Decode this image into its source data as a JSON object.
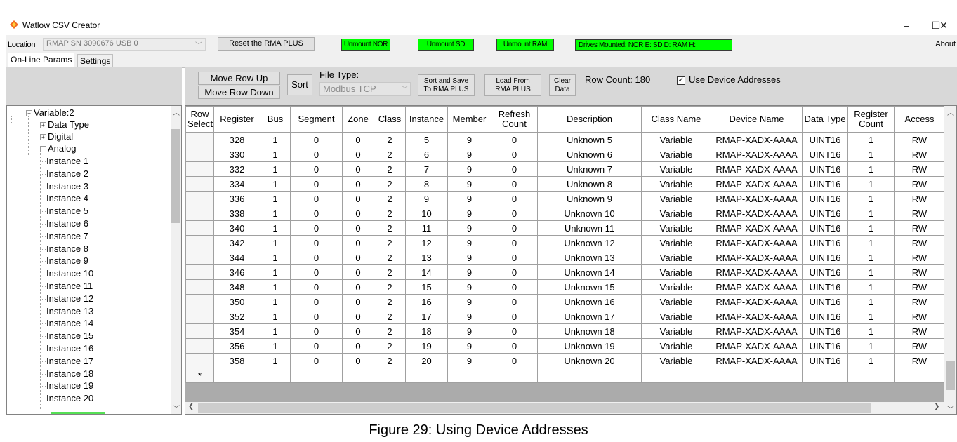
{
  "window": {
    "title": "Watlow CSV Creator",
    "minimize": "–",
    "maximize": "☐",
    "close": "✕",
    "app_icon": "watlow-logo-icon"
  },
  "toolbar": {
    "location_label": "Location",
    "location_value": "RMAP SN 3090676 USB 0",
    "reset_label": "Reset the RMA PLUS",
    "unmount_nor_label": "Unmount NOR",
    "unmount_sd_label": "Unmount SD",
    "unmount_ram_label": "Unmount RAM",
    "drives_status": "Drives Mounted: NOR E: SD D: RAM H:",
    "about_label": "About",
    "status_color": "#00ff00"
  },
  "tabs": [
    {
      "label": "On-Line Params",
      "active": true
    },
    {
      "label": "Settings",
      "active": false
    }
  ],
  "actions": {
    "move_up": "Move Row Up",
    "move_down": "Move Row Down",
    "sort": "Sort",
    "file_type_label": "File Type:",
    "file_type_value": "Modbus TCP",
    "sort_save_line1": "Sort and Save",
    "sort_save_line2": "To RMA PLUS",
    "load_line1": "Load From",
    "load_line2": "RMA PLUS",
    "clear_line1": "Clear",
    "clear_line2": "Data",
    "row_count": "Row Count: 180",
    "use_device_addresses": "Use Device Addresses",
    "use_device_addresses_checked": true
  },
  "tree": {
    "root": "Variable:2",
    "children": [
      "Data Type",
      "Digital",
      "Analog"
    ],
    "instances": [
      "Instance 1",
      "Instance 2",
      "Instance 3",
      "Instance 4",
      "Instance 5",
      "Instance 6",
      "Instance 7",
      "Instance 8",
      "Instance 9",
      "Instance 10",
      "Instance 11",
      "Instance 12",
      "Instance 13",
      "Instance 14",
      "Instance 15",
      "Instance 16",
      "Instance 17",
      "Instance 18",
      "Instance 19",
      "Instance 20"
    ]
  },
  "grid": {
    "columns": [
      "Row Select",
      "Register",
      "Bus",
      "Segment",
      "Zone",
      "Class",
      "Instance",
      "Member",
      "Refresh Count",
      "Description",
      "Class Name",
      "Device Name",
      "Data Type",
      "Register Count",
      "Access"
    ],
    "rows": [
      [
        "",
        "328",
        "1",
        "0",
        "0",
        "2",
        "5",
        "9",
        "0",
        "Unknown 5",
        "Variable",
        "RMAP-XADX-AAAA",
        "UINT16",
        "1",
        "RW"
      ],
      [
        "",
        "330",
        "1",
        "0",
        "0",
        "2",
        "6",
        "9",
        "0",
        "Unknown 6",
        "Variable",
        "RMAP-XADX-AAAA",
        "UINT16",
        "1",
        "RW"
      ],
      [
        "",
        "332",
        "1",
        "0",
        "0",
        "2",
        "7",
        "9",
        "0",
        "Unknown 7",
        "Variable",
        "RMAP-XADX-AAAA",
        "UINT16",
        "1",
        "RW"
      ],
      [
        "",
        "334",
        "1",
        "0",
        "0",
        "2",
        "8",
        "9",
        "0",
        "Unknown 8",
        "Variable",
        "RMAP-XADX-AAAA",
        "UINT16",
        "1",
        "RW"
      ],
      [
        "",
        "336",
        "1",
        "0",
        "0",
        "2",
        "9",
        "9",
        "0",
        "Unknown 9",
        "Variable",
        "RMAP-XADX-AAAA",
        "UINT16",
        "1",
        "RW"
      ],
      [
        "",
        "338",
        "1",
        "0",
        "0",
        "2",
        "10",
        "9",
        "0",
        "Unknown 10",
        "Variable",
        "RMAP-XADX-AAAA",
        "UINT16",
        "1",
        "RW"
      ],
      [
        "",
        "340",
        "1",
        "0",
        "0",
        "2",
        "11",
        "9",
        "0",
        "Unknown 11",
        "Variable",
        "RMAP-XADX-AAAA",
        "UINT16",
        "1",
        "RW"
      ],
      [
        "",
        "342",
        "1",
        "0",
        "0",
        "2",
        "12",
        "9",
        "0",
        "Unknown 12",
        "Variable",
        "RMAP-XADX-AAAA",
        "UINT16",
        "1",
        "RW"
      ],
      [
        "",
        "344",
        "1",
        "0",
        "0",
        "2",
        "13",
        "9",
        "0",
        "Unknown 13",
        "Variable",
        "RMAP-XADX-AAAA",
        "UINT16",
        "1",
        "RW"
      ],
      [
        "",
        "346",
        "1",
        "0",
        "0",
        "2",
        "14",
        "9",
        "0",
        "Unknown 14",
        "Variable",
        "RMAP-XADX-AAAA",
        "UINT16",
        "1",
        "RW"
      ],
      [
        "",
        "348",
        "1",
        "0",
        "0",
        "2",
        "15",
        "9",
        "0",
        "Unknown 15",
        "Variable",
        "RMAP-XADX-AAAA",
        "UINT16",
        "1",
        "RW"
      ],
      [
        "",
        "350",
        "1",
        "0",
        "0",
        "2",
        "16",
        "9",
        "0",
        "Unknown 16",
        "Variable",
        "RMAP-XADX-AAAA",
        "UINT16",
        "1",
        "RW"
      ],
      [
        "",
        "352",
        "1",
        "0",
        "0",
        "2",
        "17",
        "9",
        "0",
        "Unknown 17",
        "Variable",
        "RMAP-XADX-AAAA",
        "UINT16",
        "1",
        "RW"
      ],
      [
        "",
        "354",
        "1",
        "0",
        "0",
        "2",
        "18",
        "9",
        "0",
        "Unknown 18",
        "Variable",
        "RMAP-XADX-AAAA",
        "UINT16",
        "1",
        "RW"
      ],
      [
        "",
        "356",
        "1",
        "0",
        "0",
        "2",
        "19",
        "9",
        "0",
        "Unknown 19",
        "Variable",
        "RMAP-XADX-AAAA",
        "UINT16",
        "1",
        "RW"
      ],
      [
        "",
        "358",
        "1",
        "0",
        "0",
        "2",
        "20",
        "9",
        "0",
        "Unknown 20",
        "Variable",
        "RMAP-XADX-AAAA",
        "UINT16",
        "1",
        "RW"
      ],
      [
        "*",
        "",
        "",
        "",
        "",
        "",
        "",
        "",
        "",
        "",
        "",
        "",
        "",
        "",
        ""
      ]
    ]
  },
  "caption": "Figure 29: Using Device Addresses"
}
